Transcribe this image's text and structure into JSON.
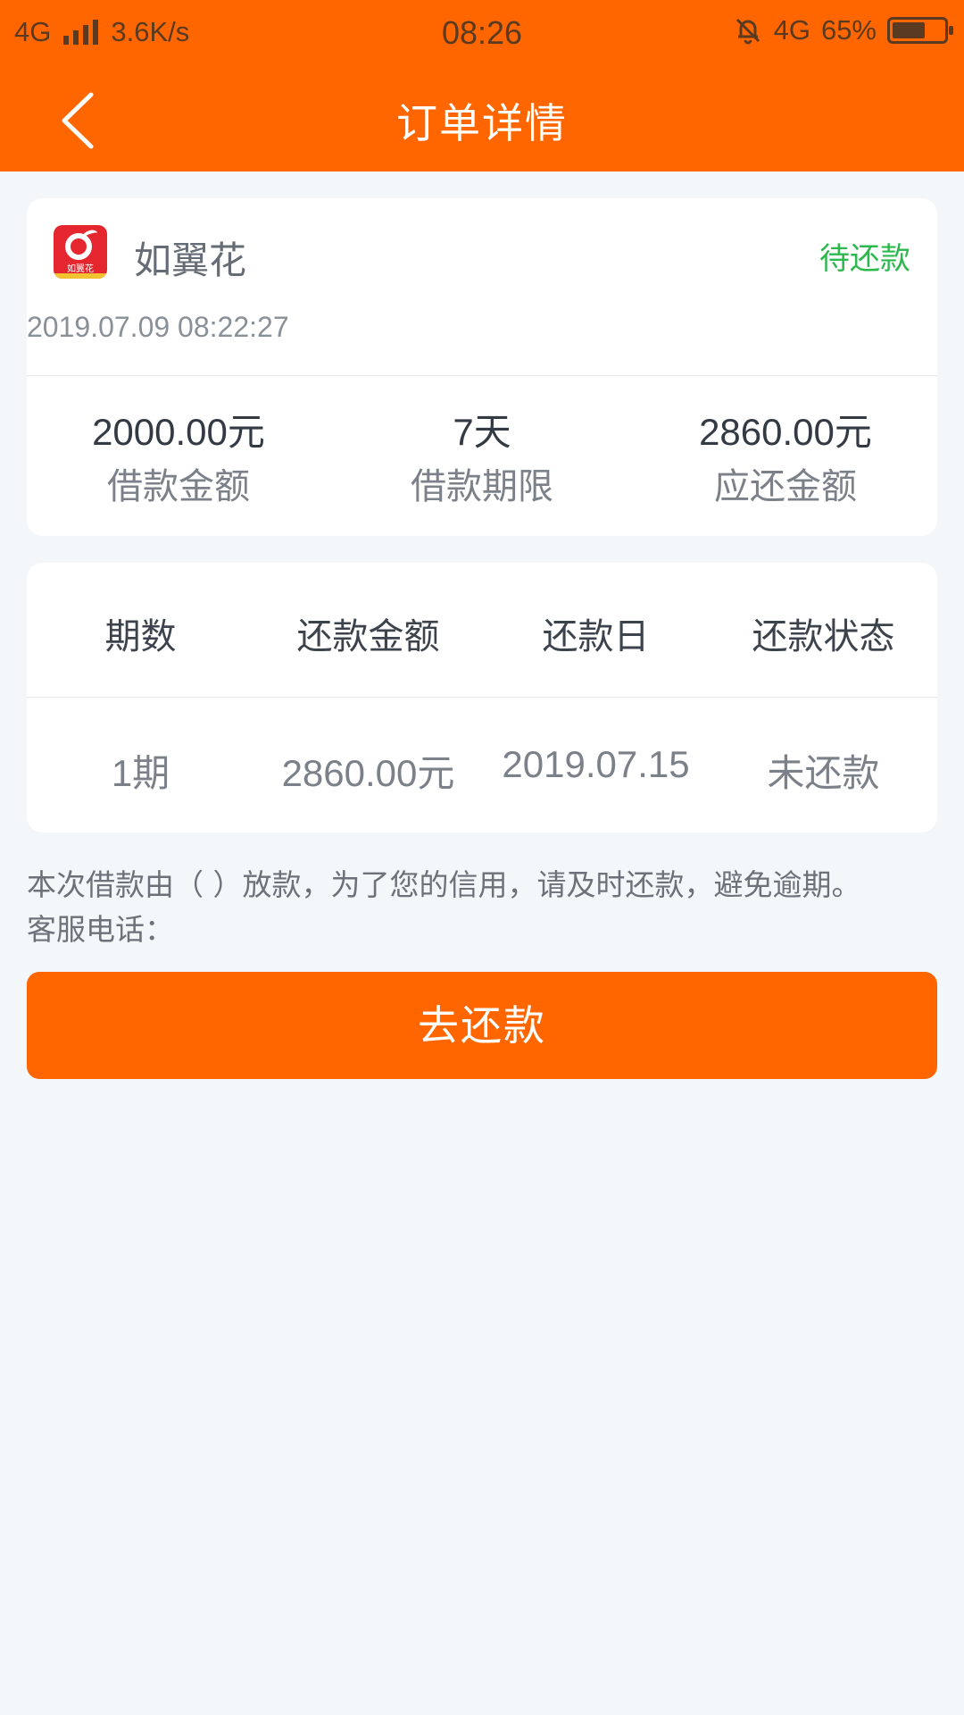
{
  "status_bar": {
    "network": "4G",
    "speed": "3.6K/s",
    "time": "08:26",
    "network_right": "4G",
    "battery": "65%"
  },
  "header": {
    "title": "订单详情",
    "back_icon": "chevron-left-icon"
  },
  "order": {
    "app_name": "如翼花",
    "logo_text": "如翼花",
    "status": "待还款",
    "datetime": "2019.07.09 08:22:27",
    "stats": [
      {
        "value": "2000.00元",
        "label": "借款金额"
      },
      {
        "value": "7天",
        "label": "借款期限"
      },
      {
        "value": "2860.00元",
        "label": "应还金额"
      }
    ]
  },
  "plan": {
    "headers": [
      "期数",
      "还款金额",
      "还款日",
      "还款状态"
    ],
    "rows": [
      [
        "1期",
        "2860.00元",
        "2019.07.15",
        "未还款"
      ]
    ]
  },
  "notice": {
    "line1": "本次借款由（ ）放款，为了您的信用，请及时还款，避免逾期。",
    "line2": "客服电话："
  },
  "actions": {
    "pay_label": "去还款"
  },
  "colors": {
    "brand": "#ff6600",
    "status_green": "#2db84d",
    "background": "#f4f7f9"
  }
}
